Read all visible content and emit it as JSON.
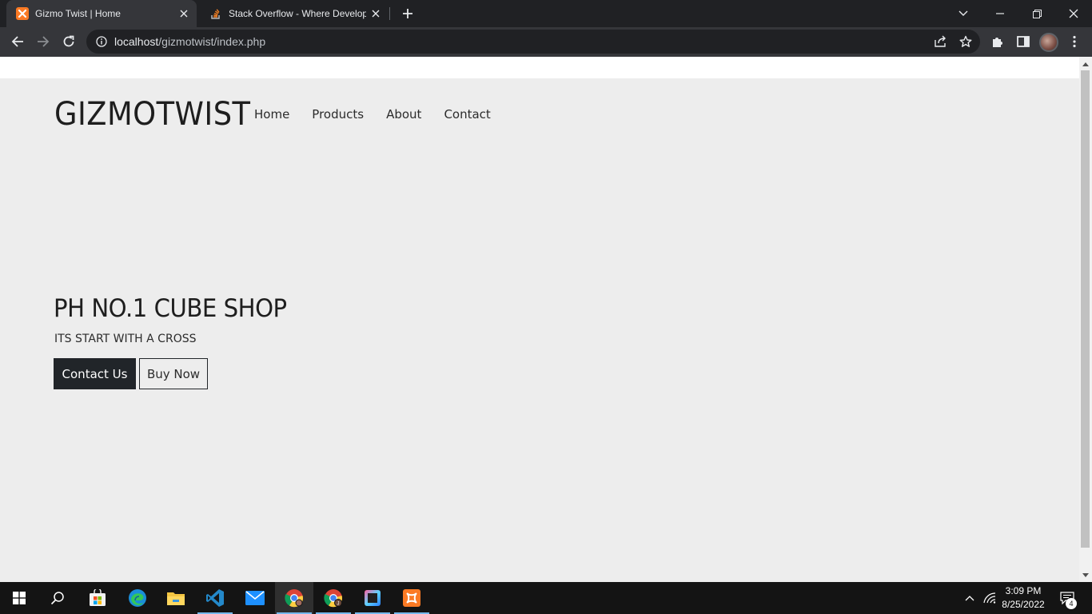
{
  "browser": {
    "tabs": [
      {
        "title": "Gizmo Twist | Home",
        "active": true,
        "favicon": "xampp-icon"
      },
      {
        "title": "Stack Overflow - Where Developers",
        "active": false,
        "favicon": "stackoverflow-icon"
      }
    ],
    "address": {
      "host": "localhost",
      "path": "/gizmotwist/index.php"
    }
  },
  "site": {
    "brand": "GIZMOTWIST",
    "nav": [
      "Home",
      "Products",
      "About",
      "Contact"
    ],
    "hero": {
      "title": "PH NO.1 CUBE SHOP",
      "subtitle": "ITS START WITH A CROSS",
      "primary_button": "Contact Us",
      "secondary_button": "Buy Now"
    }
  },
  "taskbar": {
    "apps": [
      "start-icon",
      "search-icon",
      "microsoft-store-icon",
      "edge-icon",
      "file-explorer-icon",
      "vscode-icon",
      "mail-icon",
      "chrome-icon",
      "chrome-profile-icon",
      "app-icon",
      "xampp-icon"
    ],
    "time": "3:09 PM",
    "date": "8/25/2022",
    "notifications": "4"
  },
  "colors": {
    "accent": "#212529",
    "page_bg": "#ededed",
    "taskbar_bg": "#141414",
    "chrome_bg": "#202124"
  }
}
